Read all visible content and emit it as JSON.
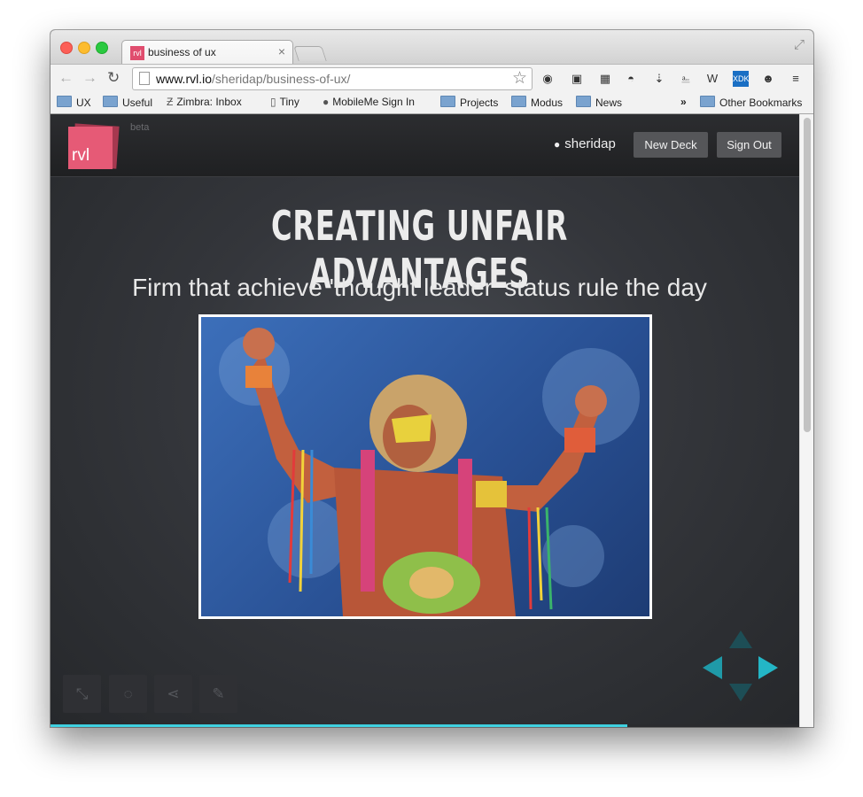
{
  "browser": {
    "tab_title": "business of ux",
    "tab_favicon_text": "rvl",
    "url_host": "www.rvl.io",
    "url_path": "/sheridap/business-of-ux/",
    "bookmarks": [
      "UX",
      "Useful",
      "Zimbra: Inbox",
      "Tiny",
      "MobileMe Sign In",
      "Projects",
      "Modus",
      "News"
    ],
    "overflow_label": "»",
    "other_bookmarks": "Other Bookmarks",
    "extension_labels": {
      "w": "W",
      "xdk": "XDK"
    }
  },
  "app": {
    "logo_text": "rvl",
    "beta_label": "beta",
    "username": "sheridap",
    "new_deck_label": "New Deck",
    "sign_out_label": "Sign Out",
    "accent_color": "#e65a76"
  },
  "slide": {
    "title": "CREATING UNFAIR ADVANTAGES",
    "subtitle": "Firm that achieve 'thought leader' status rule the day",
    "progress": 0.77
  },
  "controls": {
    "icons": [
      "fullscreen-icon",
      "comment-icon",
      "share-icon",
      "edit-pencil-icon"
    ],
    "nav_arrow_color": "#23b6c6"
  }
}
